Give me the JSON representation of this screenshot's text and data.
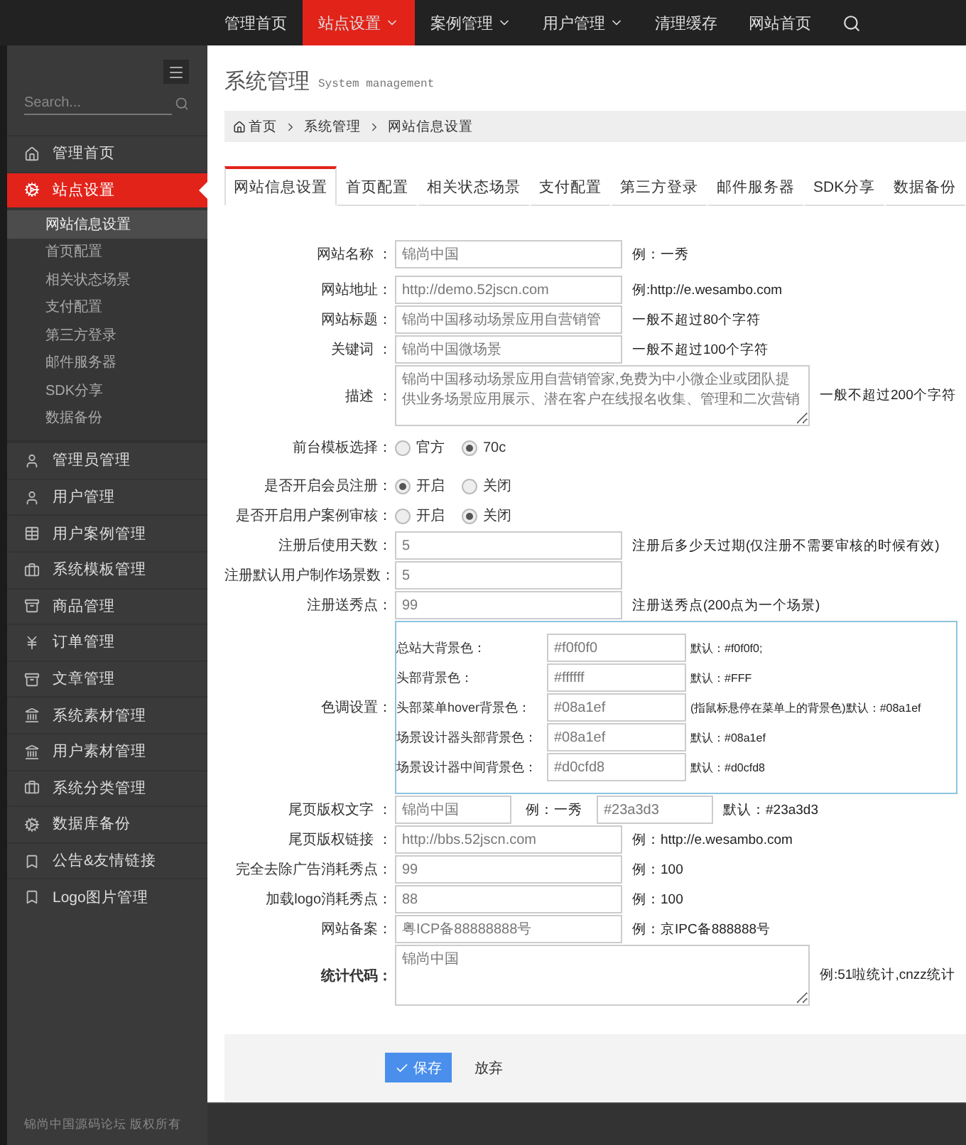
{
  "topnav": {
    "items": [
      {
        "label": "管理首页",
        "selected": false,
        "dropdown": false
      },
      {
        "label": "站点设置",
        "selected": true,
        "dropdown": true
      },
      {
        "label": "案例管理",
        "selected": false,
        "dropdown": true
      },
      {
        "label": "用户管理",
        "selected": false,
        "dropdown": true
      },
      {
        "label": "清理缓存",
        "selected": false,
        "dropdown": false
      },
      {
        "label": "网站首页",
        "selected": false,
        "dropdown": false
      }
    ]
  },
  "sidebar": {
    "search": {
      "placeholder": "Search..."
    },
    "items": [
      {
        "label": "管理首页",
        "selected": false
      },
      {
        "label": "站点设置",
        "selected": true,
        "expanded": true,
        "children": [
          {
            "label": "网站信息设置",
            "selected": true
          },
          {
            "label": "首页配置",
            "selected": false
          },
          {
            "label": "相关状态场景",
            "selected": false
          },
          {
            "label": "支付配置",
            "selected": false
          },
          {
            "label": "第三方登录",
            "selected": false
          },
          {
            "label": "邮件服务器",
            "selected": false
          },
          {
            "label": "SDK分享",
            "selected": false
          },
          {
            "label": "数据备份",
            "selected": false
          }
        ]
      },
      {
        "label": "管理员管理",
        "selected": false
      },
      {
        "label": "用户管理",
        "selected": false
      },
      {
        "label": "用户案例管理",
        "selected": false
      },
      {
        "label": "系统模板管理",
        "selected": false
      },
      {
        "label": "商品管理",
        "selected": false
      },
      {
        "label": "订单管理",
        "selected": false
      },
      {
        "label": "文章管理",
        "selected": false
      },
      {
        "label": "系统素材管理",
        "selected": false
      },
      {
        "label": "用户素材管理",
        "selected": false
      },
      {
        "label": "系统分类管理",
        "selected": false
      },
      {
        "label": "数据库备份",
        "selected": false
      },
      {
        "label": "公告&友情链接",
        "selected": false
      },
      {
        "label": "Logo图片管理",
        "selected": false
      }
    ],
    "footer": "锦尚中国源码论坛 版权所有"
  },
  "header": {
    "title": "系统管理",
    "subtitle": "System management"
  },
  "breadcrumb": [
    "首页",
    "系统管理",
    "网站信息设置"
  ],
  "tabs": [
    {
      "label": "网站信息设置",
      "selected": true
    },
    {
      "label": "首页配置",
      "selected": false
    },
    {
      "label": "相关状态场景",
      "selected": false
    },
    {
      "label": "支付配置",
      "selected": false
    },
    {
      "label": "第三方登录",
      "selected": false
    },
    {
      "label": "邮件服务器",
      "selected": false
    },
    {
      "label": "SDK分享",
      "selected": false
    },
    {
      "label": "数据备份",
      "selected": false
    }
  ],
  "form": [
    {
      "kind": "input",
      "label": "网站名称 ：",
      "value": "锦尚中国",
      "hint": "例：一秀",
      "bold": false
    },
    {
      "kind": "input",
      "label": "网站地址：",
      "value": "http://demo.52jscn.com",
      "hint": "例:http://e.wesambo.com",
      "bold": false
    },
    {
      "kind": "input",
      "label": "网站标题：",
      "value": "锦尚中国移动场景应用自营销管",
      "hint": "一般不超过80个字符",
      "bold": false
    },
    {
      "kind": "input",
      "label": "关键词 ：",
      "value": "锦尚中国微场景",
      "hint": "一般不超过100个字符",
      "bold": false
    },
    {
      "kind": "textarea",
      "label": "描述 ：",
      "value": "锦尚中国移动场景应用自营销管家,免费为中小微企业或团队提供业务场景应用展示、潜在客户在线报名收集、管理和二次营销",
      "hint": "一般不超过200个字符",
      "bold": false
    },
    {
      "kind": "radio",
      "label": "前台模板选择：",
      "options": [
        {
          "label": "官方",
          "selected": false
        },
        {
          "label": "70c",
          "selected": true
        }
      ],
      "bold": false
    },
    {
      "kind": "radio",
      "label": "是否开启会员注册：",
      "options": [
        {
          "label": "开启",
          "selected": true
        },
        {
          "label": "关闭",
          "selected": false
        }
      ],
      "bold": false
    },
    {
      "kind": "radio",
      "label": "是否开启用户案例审核：",
      "options": [
        {
          "label": "开启",
          "selected": false
        },
        {
          "label": "关闭",
          "selected": true
        }
      ],
      "bold": false
    },
    {
      "kind": "input",
      "label": "注册后使用天数：",
      "value": "5",
      "hint": "注册后多少天过期(仅注册不需要审核的时候有效)",
      "bold": false
    },
    {
      "kind": "input",
      "label": "注册默认用户制作场景数：",
      "value": "5",
      "bold": false
    },
    {
      "kind": "input",
      "label": "注册送秀点：",
      "value": "99",
      "hint": "注册送秀点(200点为一个场景)",
      "bold": false
    },
    {
      "kind": "colors",
      "label": "色调设置：",
      "bold": false,
      "colors": [
        {
          "label": "总站大背景色：",
          "value": "#f0f0f0",
          "hint": "默认：#f0f0f0;"
        },
        {
          "label": "头部背景色：",
          "value": "#ffffff",
          "hint": "默认：#FFF"
        },
        {
          "label": "头部菜单hover背景色：",
          "value": "#08a1ef",
          "hint": "(指鼠标悬停在菜单上的背景色)默认：#08a1ef"
        },
        {
          "label": "场景设计器头部背景色：",
          "value": "#08a1ef",
          "hint": "默认：#08a1ef"
        },
        {
          "label": "场景设计器中间背景色：",
          "value": "#d0cfd8",
          "hint": "默认：#d0cfd8"
        }
      ]
    },
    {
      "kind": "pair",
      "label": "尾页版权文字 ：",
      "value": "锦尚中国",
      "hint": "例：一秀",
      "value2": "#23a3d3",
      "hint2": "默认：#23a3d3",
      "bold": false
    },
    {
      "kind": "input",
      "label": "尾页版权链接 ：",
      "value": "http://bbs.52jscn.com",
      "hint": "例：http://e.wesambo.com",
      "bold": false
    },
    {
      "kind": "input",
      "label": "完全去除广告消耗秀点：",
      "value": "99",
      "hint": "例：100",
      "bold": false
    },
    {
      "kind": "input",
      "label": "加载logo消耗秀点：",
      "value": "88",
      "hint": "例：100",
      "bold": false
    },
    {
      "kind": "input",
      "label": "网站备案：",
      "value": "粤ICP备88888888号",
      "hint": "例：京IPC备888888号",
      "bold": false
    },
    {
      "kind": "textarea",
      "label": "统计代码：",
      "value": "锦尚中国",
      "hint": "例:51啦统计,cnzz统计",
      "bold": true
    }
  ],
  "actions": {
    "save": "保存",
    "cancel": "放弃"
  }
}
